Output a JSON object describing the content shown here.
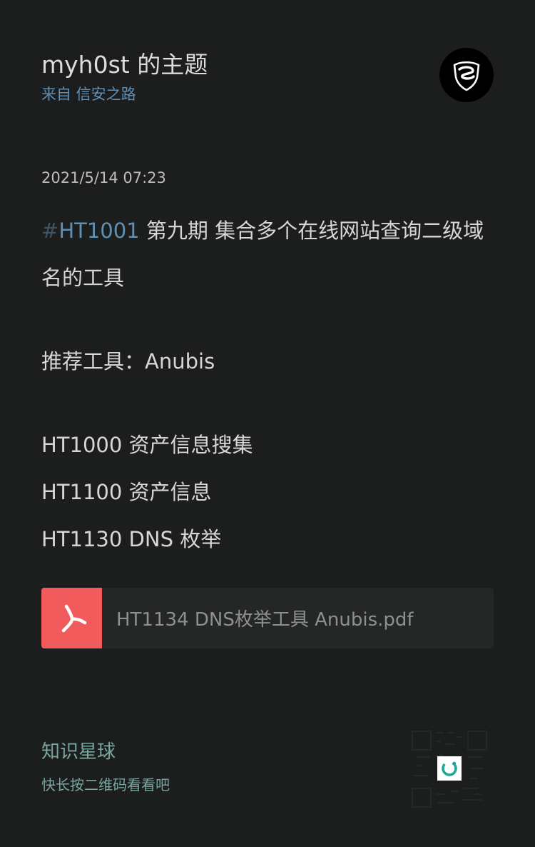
{
  "header": {
    "title": "myh0st 的主题",
    "source": "来自 信安之路"
  },
  "post": {
    "timestamp": "2021/5/14 07:23",
    "hashtag_sign": "#",
    "hashtag": "HT1001",
    "headline_rest": " 第九期 集合多个在线网站查询二级域名的工具",
    "recommend": "推荐工具：Anubis",
    "lines": [
      "HT1000 资产信息搜集",
      "HT1100 资产信息",
      "HT1130 DNS 枚举"
    ]
  },
  "attachment": {
    "filename": "HT1134 DNS枚举工具 Anubis.pdf",
    "icon": "pdf-icon",
    "icon_color": "#f25b5b"
  },
  "footer": {
    "brand": "知识星球",
    "hint": "快长按二维码看看吧"
  },
  "colors": {
    "background": "#1c1d1d",
    "link": "#5f8fb2",
    "footer": "#7aa6a0"
  }
}
